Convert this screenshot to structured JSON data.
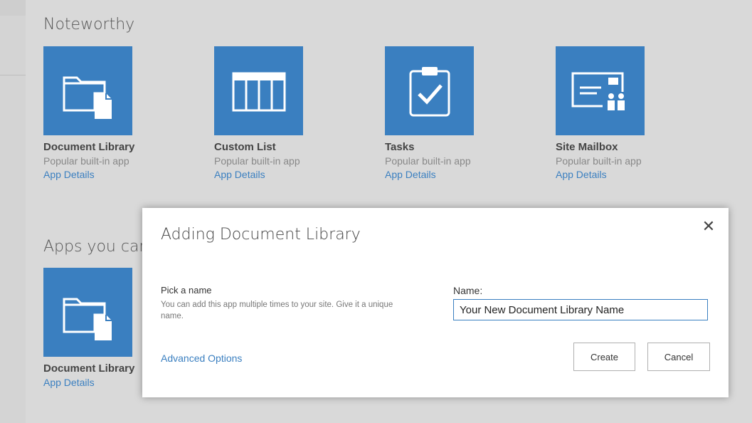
{
  "sections": {
    "noteworthy_title": "Noteworthy",
    "apps_title": "Apps you can add"
  },
  "noteworthy_tiles": [
    {
      "name": "Document Library",
      "subtitle": "Popular built-in app",
      "link": "App Details",
      "icon": "folder-document-icon"
    },
    {
      "name": "Custom List",
      "subtitle": "Popular built-in app",
      "link": "App Details",
      "icon": "list-table-icon"
    },
    {
      "name": "Tasks",
      "subtitle": "Popular built-in app",
      "link": "App Details",
      "icon": "clipboard-check-icon"
    },
    {
      "name": "Site Mailbox",
      "subtitle": "Popular built-in app",
      "link": "App Details",
      "icon": "mailbox-people-icon"
    }
  ],
  "apps_tiles": [
    {
      "name": "Document Library",
      "link": "App Details",
      "icon": "folder-document-icon"
    }
  ],
  "dialog": {
    "title": "Adding Document Library",
    "close_glyph": "✕",
    "pick_label": "Pick a name",
    "pick_description": "You can add this app multiple times to your site. Give it a unique name.",
    "name_label": "Name:",
    "name_value": "Your New Document Library Name",
    "advanced_link": "Advanced Options",
    "create_label": "Create",
    "cancel_label": "Cancel"
  },
  "colors": {
    "tile_blue": "#3a7fc0",
    "link_blue": "#3a7fc0",
    "page_background": "#d9d9d9"
  }
}
